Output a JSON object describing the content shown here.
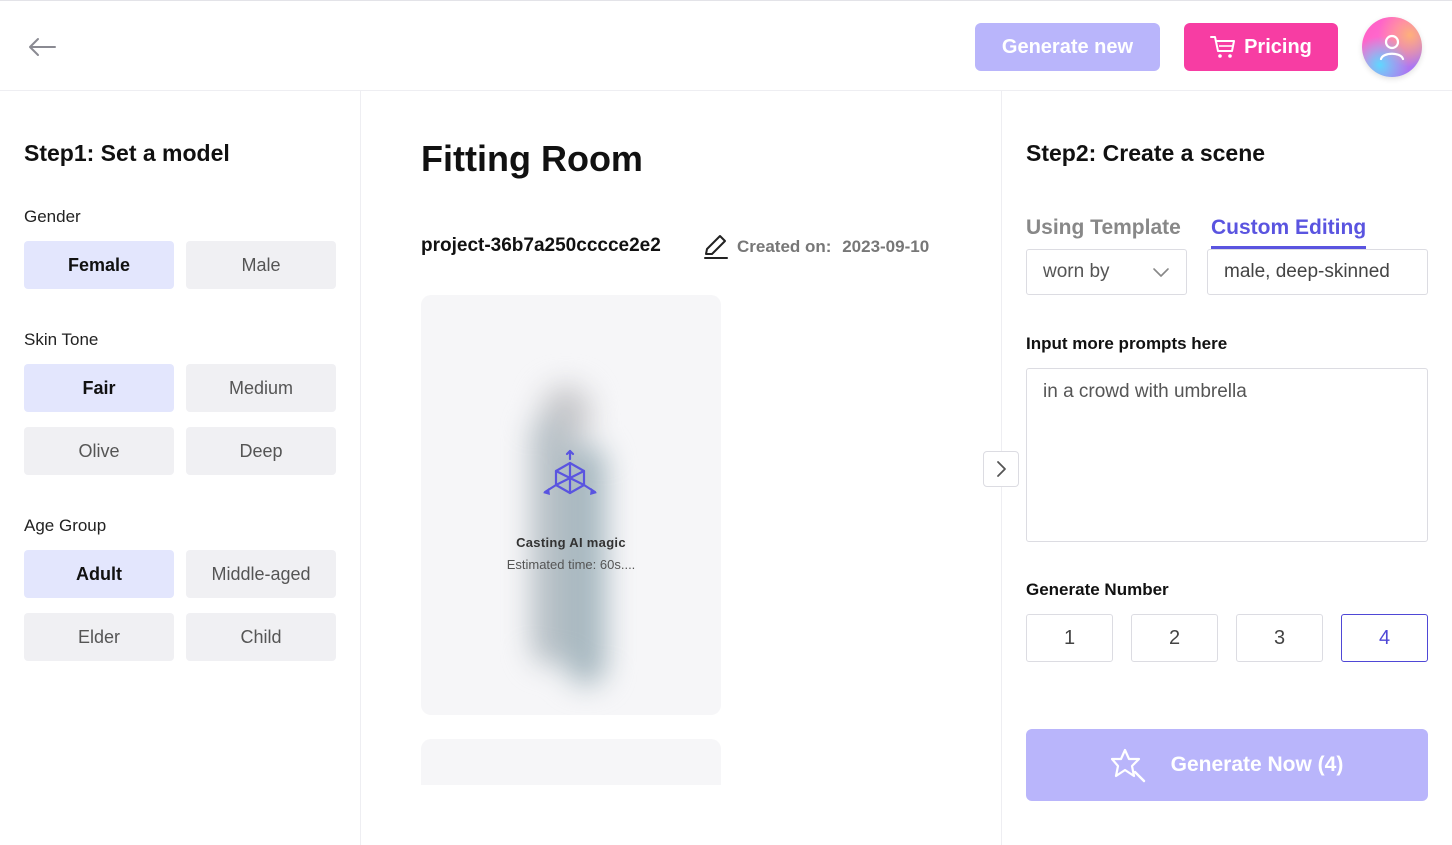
{
  "header": {
    "generate_new_label": "Generate new",
    "pricing_label": "Pricing"
  },
  "left": {
    "title": "Step1: Set a model",
    "gender": {
      "label": "Gender",
      "options": [
        {
          "label": "Female",
          "selected": true
        },
        {
          "label": "Male",
          "selected": false
        }
      ]
    },
    "skin_tone": {
      "label": "Skin Tone",
      "options": [
        {
          "label": "Fair",
          "selected": true
        },
        {
          "label": "Medium",
          "selected": false
        },
        {
          "label": "Olive",
          "selected": false
        },
        {
          "label": "Deep",
          "selected": false
        }
      ]
    },
    "age_group": {
      "label": "Age Group",
      "options": [
        {
          "label": "Adult",
          "selected": true
        },
        {
          "label": "Middle-aged",
          "selected": false
        },
        {
          "label": "Elder",
          "selected": false
        },
        {
          "label": "Child",
          "selected": false
        }
      ]
    }
  },
  "main": {
    "title": "Fitting Room",
    "project_name": "project-36b7a250cccce2e2",
    "created_label": "Created on:",
    "created_date": "2023-09-10",
    "loading": {
      "title": "Casting AI magic",
      "subtitle": "Estimated time: 60s...."
    }
  },
  "right": {
    "title": "Step2: Create a scene",
    "tabs": [
      {
        "label": "Using Template",
        "active": false
      },
      {
        "label": "Custom Editing",
        "active": true
      }
    ],
    "relation_select": "worn by",
    "subject_value": "male, deep-skinned",
    "prompt_label": "Input more prompts here",
    "prompt_value": "in a crowd with umbrella",
    "generate_number_label": "Generate Number",
    "numbers": [
      {
        "label": "1",
        "selected": false
      },
      {
        "label": "2",
        "selected": false
      },
      {
        "label": "3",
        "selected": false
      },
      {
        "label": "4",
        "selected": true
      }
    ],
    "generate_now_label": "Generate Now (4)"
  },
  "colors": {
    "accent": "#5a54e0",
    "pricing": "#f73da3",
    "disabled_primary": "#b9b5fb",
    "selected_option_bg": "#e3e6fd"
  }
}
